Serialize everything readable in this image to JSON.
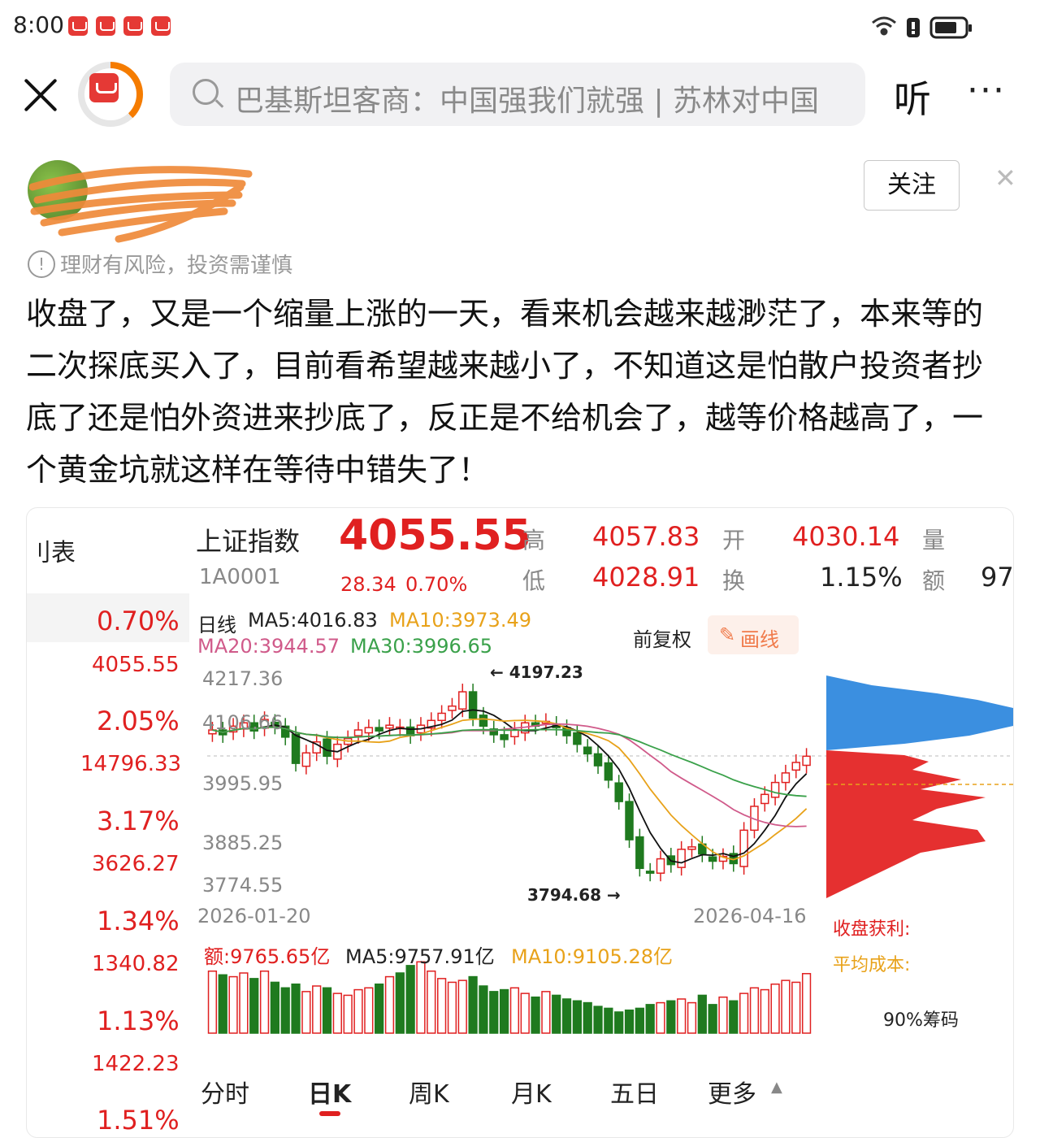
{
  "status_bar": {
    "time": "8:00",
    "app_icons": [
      "huawei-icon",
      "huawei-icon",
      "huawei-icon",
      "huawei-icon"
    ],
    "right_icons": [
      "wifi-icon",
      "alert-icon",
      "battery-icon"
    ]
  },
  "header": {
    "search_placeholder": "巴基斯坦客商：中国强我们就强 | 苏林对中国",
    "listen_label": "听",
    "more_label": "···"
  },
  "author": {
    "follow_label": "关注",
    "close_label": "✕"
  },
  "risk_notice": {
    "icon": "!",
    "text": "理财有风险，投资需谨慎"
  },
  "post_text": "收盘了，又是一个缩量上涨的一天，看来机会越来越渺茫了，本来等的二次探底买入了，目前看希望越来越小了，不知道这是怕散户投资者抄底了还是怕外资进来抄底了，反正是不给机会了，越等价格越高了，一个黄金坑就这样在等待中错失了！",
  "stock": {
    "side_title": "刂表",
    "side_rows": [
      {
        "pct": "0.70%",
        "val": "4055.55"
      },
      {
        "pct": "2.05%",
        "val": "14796.33"
      },
      {
        "pct": "3.17%",
        "val": "3626.27"
      },
      {
        "pct": "1.34%",
        "val": "1340.82"
      },
      {
        "pct": "1.13%",
        "val": "1422.23"
      },
      {
        "pct": "1.51%",
        "val": ""
      }
    ],
    "name": "上证指数",
    "code": "1A0001",
    "price": "4055.55",
    "change": "28.34",
    "change_pct": "0.70%",
    "high_label": "高",
    "high": "4057.83",
    "low_label": "低",
    "low": "4028.91",
    "open_label": "开",
    "open": "4030.14",
    "turnover_label": "换",
    "turnover": "1.15%",
    "volume_label": "量",
    "amount_label": "额",
    "amount_partial": "97",
    "ma_line1": {
      "period": "日线",
      "ma5": "MA5:4016.83",
      "ma10": "MA10:3973.49"
    },
    "ma_line2": {
      "ma20": "MA20:3944.57",
      "ma30": "MA30:3996.65"
    },
    "adjust_label": "前复权",
    "draw_label": "画线",
    "y_ticks": [
      "4217.36",
      "4106.66",
      "3995.95",
      "3885.25",
      "3774.55"
    ],
    "high_marker": "4197.23",
    "low_marker": "3794.68",
    "date_start": "2026-01-20",
    "date_end": "2026-04-16",
    "profit_label": "收盘获利:",
    "avgcost_label": "平均成本:",
    "chip_label": "90%筹码",
    "vol_amount": "额:9765.65亿",
    "vol_ma5": "MA5:9757.91亿",
    "vol_ma10": "MA10:9105.28亿",
    "tabs": [
      "分时",
      "日K",
      "周K",
      "月K",
      "五日",
      "更多"
    ],
    "active_tab": "日K",
    "colors": {
      "up": "#e02020",
      "down": "#1f7a1f",
      "ma5": "#111111",
      "ma10": "#e8a21a",
      "ma20": "#d05a8a",
      "ma30": "#3aa14a",
      "chip_up": "#3b8fe0",
      "chip_down": "#e53030"
    }
  },
  "chart_data": {
    "type": "candlestick",
    "title": "上证指数",
    "x_start": "2026-01-20",
    "x_end": "2026-04-16",
    "ylim": [
      3774.55,
      4217.36
    ],
    "series": [
      {
        "name": "收盘",
        "values": [
          4110,
          4100,
          4118,
          4125,
          4108,
          4132,
          4118,
          4095,
          4040,
          4062,
          4085,
          4055,
          4080,
          4092,
          4110,
          4115,
          4108,
          4120,
          4116,
          4098,
          4120,
          4130,
          4145,
          4160,
          4190,
          4135,
          4118,
          4100,
          4090,
          4110,
          4125,
          4118,
          4128,
          4115,
          4098,
          4080,
          4060,
          4035,
          4005,
          3960,
          3880,
          3820,
          3810,
          3840,
          3828,
          3860,
          3865,
          3850,
          3835,
          3845,
          3830,
          3900,
          3950,
          3975,
          4000,
          4020,
          4042,
          4055
        ]
      },
      {
        "name": "成交额(亿)",
        "values": [
          9900,
          9700,
          9600,
          9800,
          9500,
          9900,
          9300,
          9000,
          9200,
          8800,
          9100,
          9000,
          8700,
          8600,
          8900,
          9000,
          9200,
          9600,
          9800,
          10200,
          10400,
          9900,
          9500,
          9300,
          9400,
          9600,
          9100,
          8800,
          8900,
          9000,
          8700,
          8500,
          8800,
          8600,
          8400,
          8300,
          8200,
          8000,
          7900,
          7700,
          7800,
          7900,
          8100,
          8200,
          8300,
          8400,
          8200,
          8600,
          8100,
          8500,
          8300,
          8700,
          9000,
          8900,
          9200,
          9400,
          9300,
          9765.65
        ]
      }
    ]
  }
}
